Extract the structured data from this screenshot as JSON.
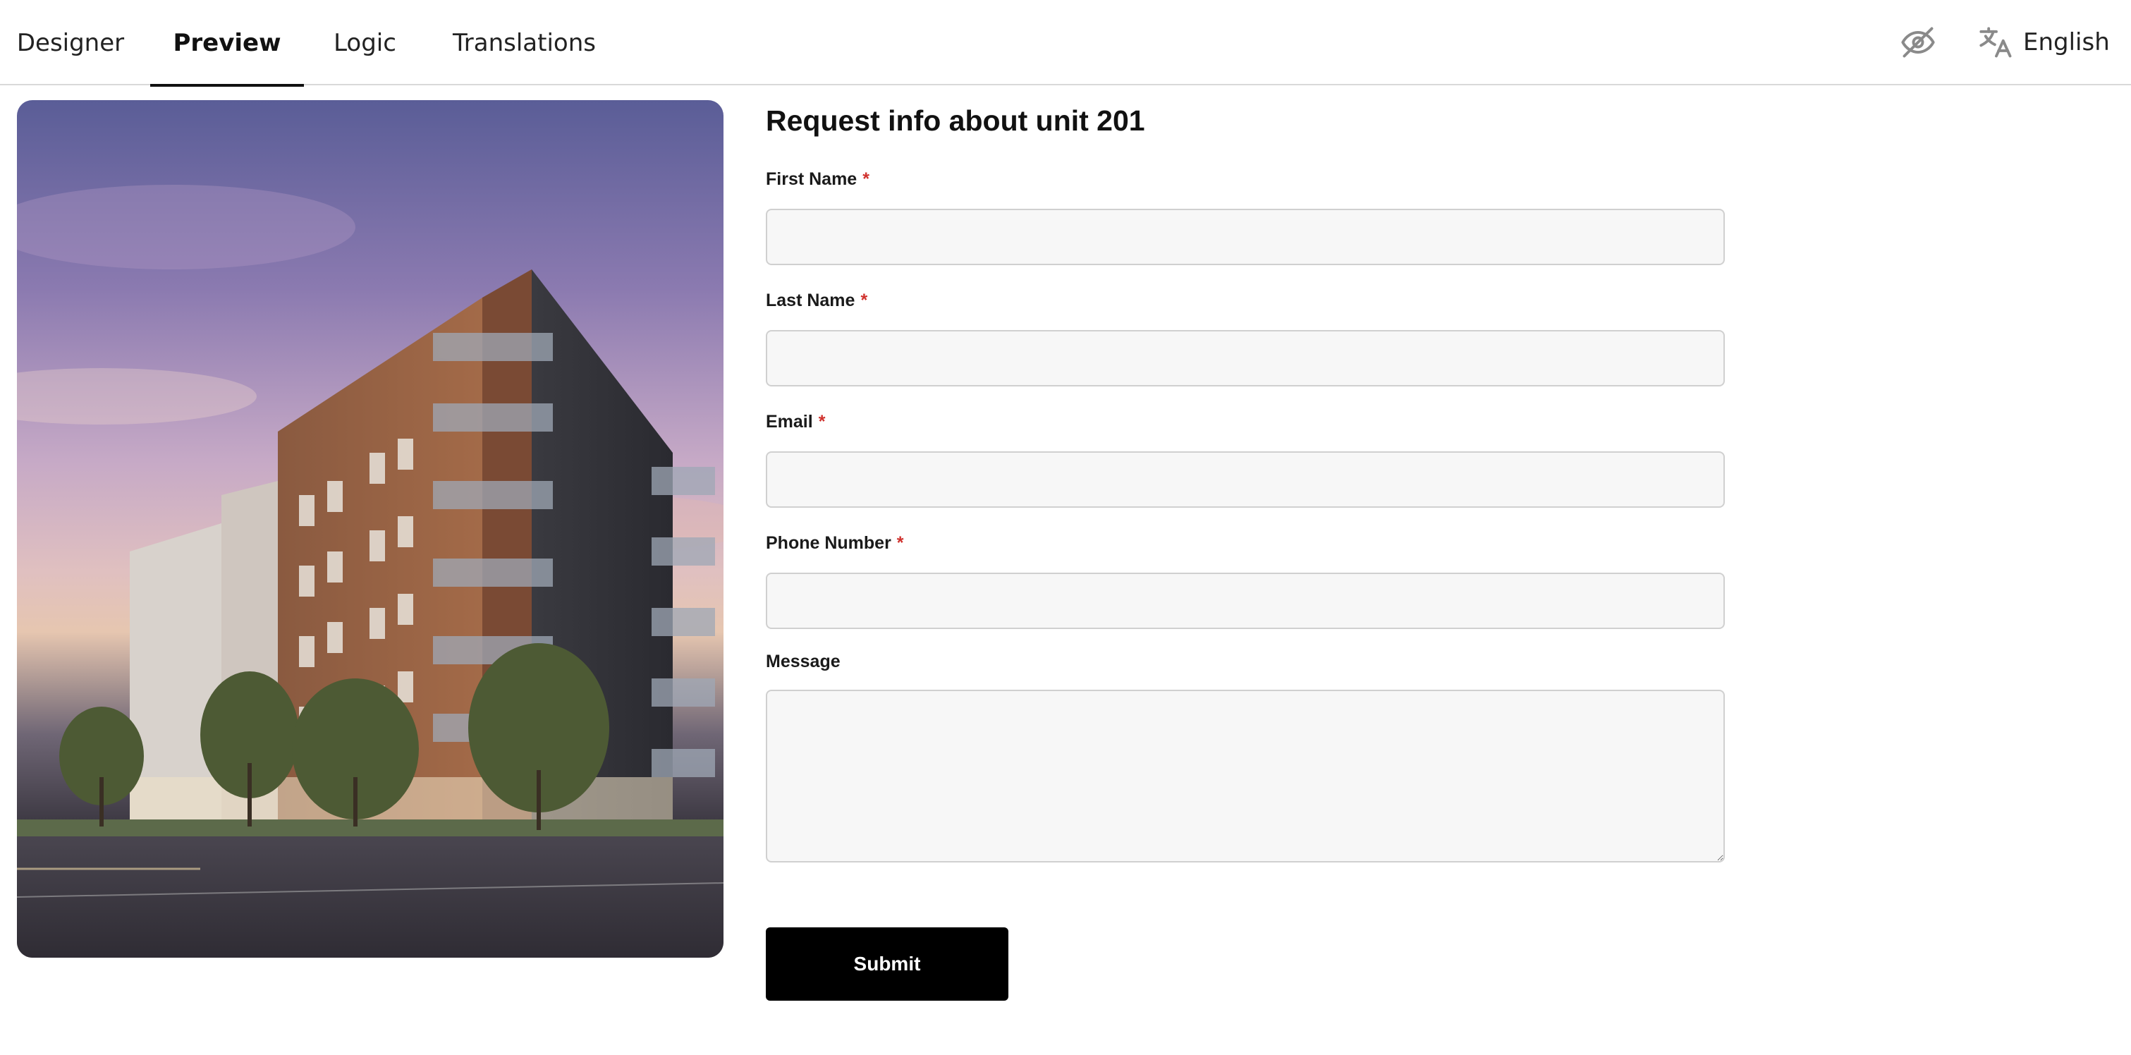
{
  "nav": {
    "tabs": [
      {
        "label": "Designer"
      },
      {
        "label": "Preview"
      },
      {
        "label": "Logic"
      },
      {
        "label": "Translations"
      }
    ],
    "active_tab": "Preview",
    "language": "English",
    "icons": {
      "visibility": "eye-off-icon",
      "translate": "translate-icon"
    }
  },
  "hero": {
    "image_description": "building-photo"
  },
  "form": {
    "title": "Request info about unit 201",
    "required_marker": "*",
    "fields": [
      {
        "label": "First Name",
        "required": true,
        "value": ""
      },
      {
        "label": "Last Name",
        "required": true,
        "value": ""
      },
      {
        "label": "Email",
        "required": true,
        "value": ""
      },
      {
        "label": "Phone Number",
        "required": true,
        "value": ""
      },
      {
        "label": "Message",
        "required": false,
        "value": ""
      }
    ],
    "submit_label": "Submit"
  },
  "colors": {
    "accent": "#000000",
    "required": "#d0312d",
    "input_bg": "#f7f7f7",
    "border": "#d0d0d0"
  }
}
